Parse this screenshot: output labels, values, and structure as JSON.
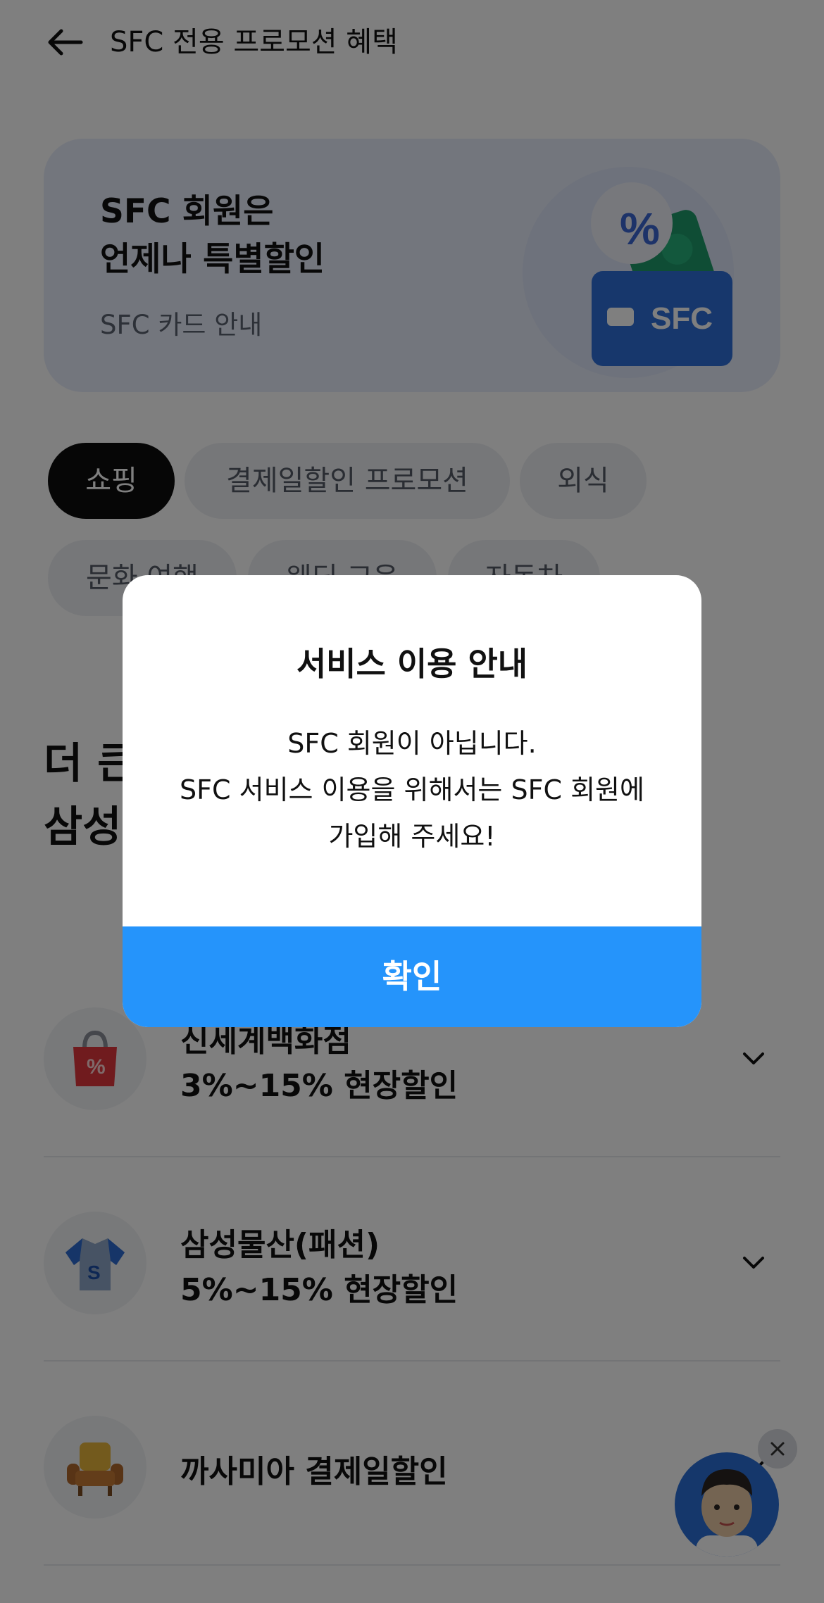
{
  "header": {
    "title": "SFC 전용 프로모션 혜택",
    "back_icon": "arrow-left-icon"
  },
  "banner": {
    "title": "SFC 회원은\n언제나 특별할인",
    "link": "SFC 카드 안내",
    "card_text": "SFC"
  },
  "chips": [
    {
      "label": "쇼핑",
      "active": true
    },
    {
      "label": "결제일할인 프로모션",
      "active": false
    },
    {
      "label": "외식",
      "active": false
    },
    {
      "label": "문화 여행",
      "active": false
    },
    {
      "label": "웨딩 교육",
      "active": false
    },
    {
      "label": "자동차",
      "active": false
    }
  ],
  "section": {
    "title": "더 큰\n삼성"
  },
  "benefits": [
    {
      "name": "신세계백화점",
      "desc": "3%~15% 현장할인",
      "icon": "shopping-bag-icon"
    },
    {
      "name": "삼성물산(패션)",
      "desc": "5%~15% 현장할인",
      "icon": "shirt-icon"
    },
    {
      "name": "까사미아 결제일할인",
      "desc": "",
      "icon": "armchair-icon"
    }
  ],
  "modal": {
    "title": "서비스 이용 안내",
    "lines": [
      "SFC 회원이 아닙니다.",
      "SFC 서비스 이용을 위해서는 SFC 회원에",
      "가입해 주세요!"
    ],
    "confirm_label": "확인"
  },
  "colors": {
    "accent": "#2594fb",
    "chip_active": "#0d0d0d",
    "banner_bg": "#e7ecfa",
    "card_blue": "#2f6fd8"
  }
}
